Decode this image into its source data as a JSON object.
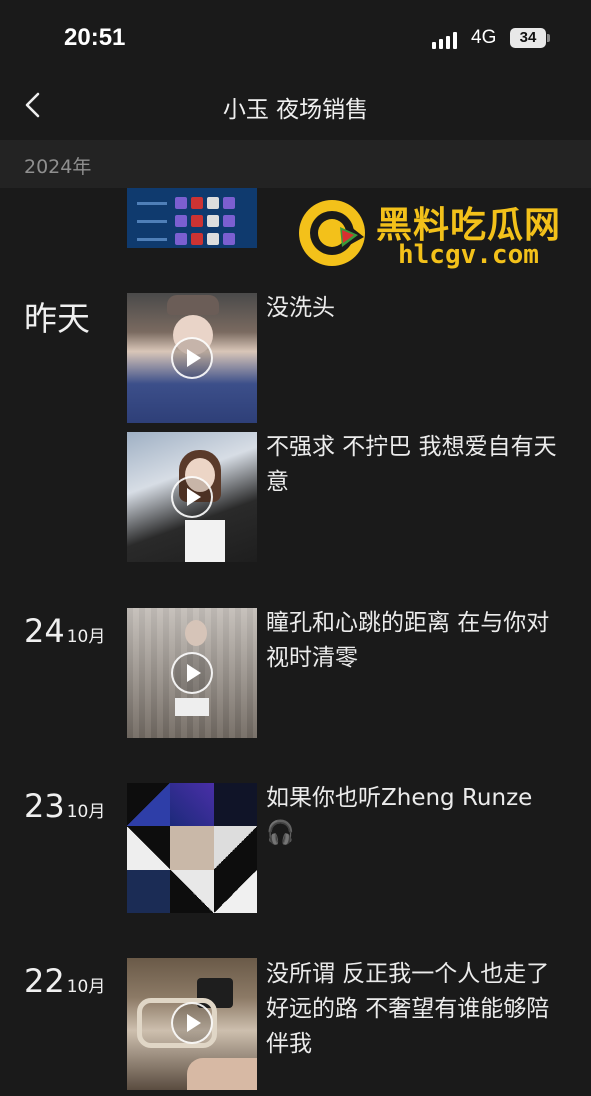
{
  "status_bar": {
    "time": "20:51",
    "network": "4G",
    "battery": "34"
  },
  "header": {
    "title": "小玉 夜场销售"
  },
  "year_label": "2024年",
  "watermark": {
    "name": "黑料吃瓜网",
    "url": "hlcgv.com"
  },
  "yesterday_label": "昨天",
  "posts": [
    {
      "caption": "没洗头"
    },
    {
      "caption": "不强求 不拧巴 我想爱自有天意"
    },
    {
      "day": "24",
      "month": "10月",
      "caption": "瞳孔和心跳的距离 在与你对视时清零"
    },
    {
      "day": "23",
      "month": "10月",
      "caption": "如果你也听Zheng Runze 🎧"
    },
    {
      "day": "22",
      "month": "10月",
      "caption": "没所谓 反正我一个人也走了好远的路 不奢望有谁能够陪伴我"
    }
  ]
}
